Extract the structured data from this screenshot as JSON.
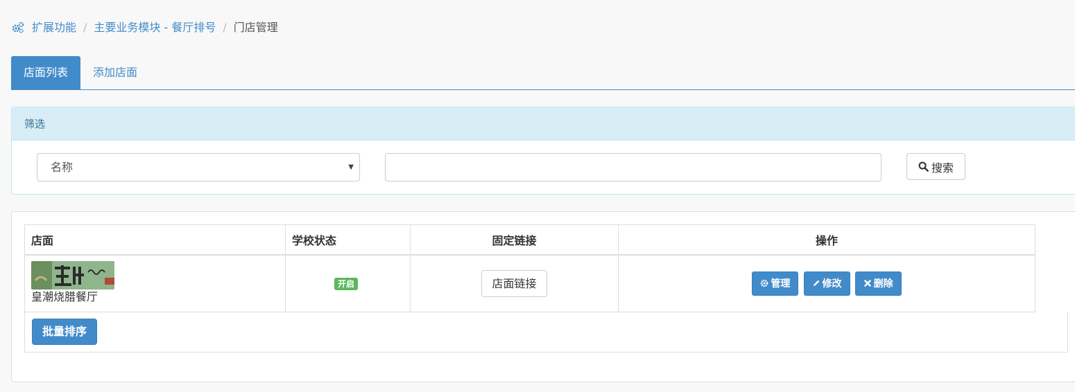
{
  "breadcrumb": {
    "items": [
      "扩展功能",
      "主要业务模块 - 餐厅排号",
      "门店管理"
    ]
  },
  "tabs": [
    {
      "label": "店面列表",
      "active": true
    },
    {
      "label": "添加店面",
      "active": false
    }
  ],
  "filter": {
    "title": "筛选",
    "field_select": "名称",
    "keyword_value": "",
    "search_label": "搜索"
  },
  "table": {
    "headers": [
      "店面",
      "学校状态",
      "固定链接",
      "操作"
    ],
    "rows": [
      {
        "store_name": "皇潮烧腊餐厅",
        "status": "开启",
        "link_label": "店面链接",
        "actions": {
          "manage": "管理",
          "edit": "修改",
          "delete": "删除"
        }
      }
    ],
    "batch_label": "批量排序"
  },
  "colors": {
    "primary": "#428bca",
    "success": "#5cb85c",
    "info_bg": "#d9edf7",
    "info_text": "#31708f"
  },
  "icons": {
    "breadcrumb": "gears-icon",
    "search": "search-icon",
    "manage": "gear-icon",
    "edit": "pencil-icon",
    "delete": "times-icon"
  }
}
